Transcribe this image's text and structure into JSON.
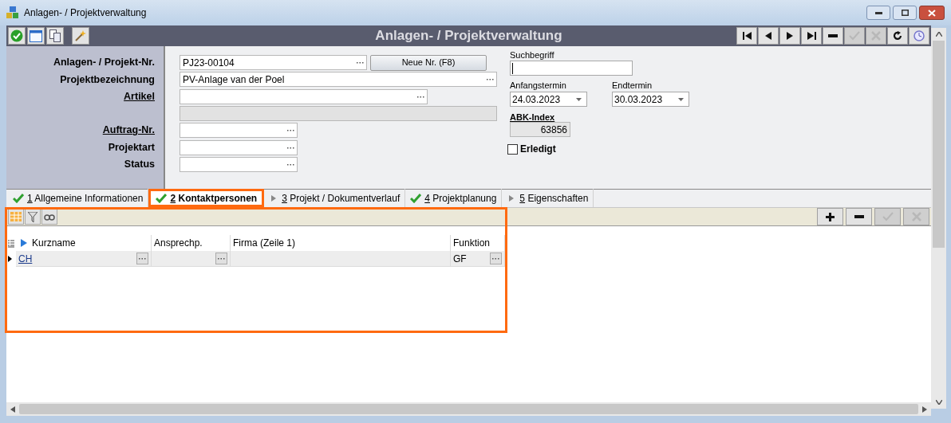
{
  "window": {
    "title": "Anlagen- / Projektverwaltung"
  },
  "header": {
    "title": "Anlagen- / Projektverwaltung"
  },
  "nav_buttons": [
    {
      "kind": "first",
      "disabled": false
    },
    {
      "kind": "prev",
      "disabled": false
    },
    {
      "kind": "next",
      "disabled": false
    },
    {
      "kind": "last",
      "disabled": false
    },
    {
      "kind": "remove",
      "disabled": false
    },
    {
      "kind": "confirm",
      "disabled": true
    },
    {
      "kind": "cancel",
      "disabled": true
    },
    {
      "kind": "refresh",
      "disabled": false
    },
    {
      "kind": "clock",
      "disabled": false
    }
  ],
  "form": {
    "fields": [
      {
        "label": "Anlagen- / Projekt-Nr.",
        "link": false,
        "value": "PJ23-00104",
        "disabled": false,
        "button": "Neue Nr. (F8)"
      },
      {
        "label": "Projektbezeichnung",
        "link": false,
        "value": "PV-Anlage van der Poel",
        "disabled": false
      },
      {
        "label": "Artikel",
        "link": true,
        "disabled": false
      },
      {
        "disabled": true
      },
      {
        "label": "Auftrag-Nr.",
        "link": true,
        "disabled": false
      },
      {
        "label": "Projektart",
        "link": false,
        "disabled": false
      },
      {
        "label": "Status",
        "link": false,
        "disabled": false
      }
    ],
    "search": {
      "label": "Suchbegriff",
      "focused": true
    },
    "dates": [
      {
        "label": "Anfangstermin",
        "value": "24.03.2023"
      },
      {
        "label": "Endtermin",
        "value": "30.03.2023"
      }
    ],
    "abk_index": {
      "label": "ABK-Index",
      "value": "63856"
    },
    "erledigt": {
      "label": "Erledigt",
      "checked": false
    }
  },
  "tabs": [
    {
      "number": "1",
      "label": "Allgemeine Informationen",
      "done": true,
      "selected": false
    },
    {
      "number": "2",
      "label": "Kontaktpersonen",
      "done": true,
      "selected": true
    },
    {
      "number": "3",
      "label": "Projekt / Dokumentverlauf",
      "done": false,
      "selected": false
    },
    {
      "number": "4",
      "label": "Projektplanung",
      "done": true,
      "selected": false
    },
    {
      "number": "5",
      "label": "Eigenschaften",
      "done": false,
      "selected": false
    }
  ],
  "grid_buttons": [
    {
      "kind": "add",
      "disabled": false
    },
    {
      "kind": "remove",
      "disabled": false
    },
    {
      "kind": "confirm",
      "disabled": true
    },
    {
      "kind": "cancel",
      "disabled": true
    }
  ],
  "table": {
    "columns": [
      {
        "label": "Kurzname",
        "sorted": true
      },
      {
        "label": "Ansprechp.",
        "sorted": false
      },
      {
        "label": "Firma (Zeile 1)",
        "sorted": false
      },
      {
        "label": "Funktion",
        "sorted": false
      }
    ],
    "rows": [
      {
        "current": true,
        "cells": [
          {
            "text": "CH",
            "link": true,
            "lookup": true
          },
          {
            "lookup": true
          },
          {
            "lookup": false
          },
          {
            "text": "GF",
            "lookup": true
          }
        ]
      }
    ]
  }
}
